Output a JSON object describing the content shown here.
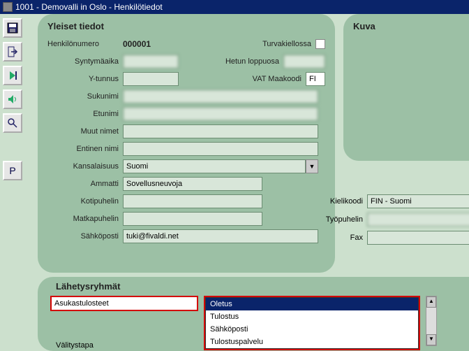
{
  "window": {
    "title": "1001 - Demovalli in Oslo - Henkilötiedot"
  },
  "toolbar": {
    "print_btn": "P"
  },
  "general": {
    "section_title": "Yleiset tiedot",
    "henkno_lbl": "Henkilönumero",
    "henkno_val": "000001",
    "turvakielto_lbl": "Turvakiellossa",
    "syntymaika_lbl": "Syntymäaika",
    "hetun_lbl": "Hetun loppuosa",
    "ytunnus_lbl": "Y-tunnus",
    "vat_lbl": "VAT Maakoodi",
    "vat_val": "FI",
    "sukunimi_lbl": "Sukunimi",
    "etunimi_lbl": "Etunimi",
    "muut_lbl": "Muut nimet",
    "entinen_lbl": "Entinen nimi",
    "kansal_lbl": "Kansalaisuus",
    "kansal_val": "Suomi",
    "ammatti_lbl": "Ammatti",
    "ammatti_val": "Sovellusneuvoja",
    "kotipuh_lbl": "Kotipuhelin",
    "matkapuh_lbl": "Matkapuhelin",
    "sahkoposti_lbl": "Sähköposti",
    "sahkoposti_val": "tuki@fivaldi.net",
    "kieli_lbl": "Kielikoodi",
    "kieli_val": "FIN - Suomi",
    "tyopuh_lbl": "Työpuhelin",
    "fax_lbl": "Fax"
  },
  "kuva": {
    "title": "Kuva"
  },
  "send": {
    "title": "Lähetysryhmät",
    "field_lbl": "Asukastulosteet",
    "options": [
      "Oletus",
      "Tulostus",
      "Sähköposti",
      "Tulostuspalvelu"
    ],
    "valitys_lbl": "Välitystapa"
  }
}
